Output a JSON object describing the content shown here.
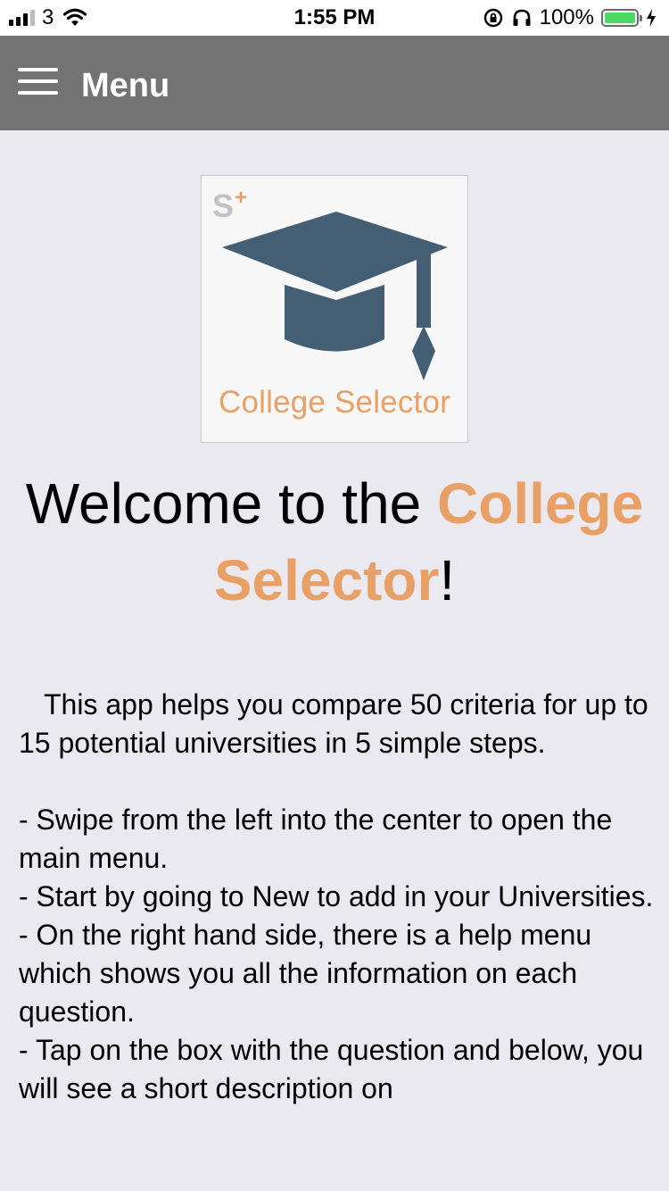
{
  "status_bar": {
    "carrier": "3",
    "time": "1:55 PM",
    "battery_percent": "100%",
    "battery_level": 1.0,
    "signal_bars_filled": 3,
    "signal_bars_total": 4,
    "icons": [
      "signal-icon",
      "wifi-icon",
      "orientation-lock-icon",
      "headphones-icon",
      "battery-icon",
      "charging-icon"
    ]
  },
  "nav": {
    "menu_icon": "hamburger-menu-icon",
    "title": "Menu"
  },
  "logo": {
    "badge": "S+",
    "text": "College Selector",
    "icon": "graduation-cap-icon"
  },
  "welcome": {
    "prefix": "Welcome to the ",
    "app_name": "College Selector",
    "suffix": "!"
  },
  "body": {
    "intro": "This app helps you compare 50 criteria for up to 15 potential universities in 5 simple steps.",
    "bullets": [
      "- Swipe from the left into the center to open the main menu.",
      "- Start by going to New to add in your Universities.",
      "- On the right hand side, there is a help menu which shows you all the information on each question.",
      "- Tap on the box with the question and below, you will see a short description on"
    ]
  },
  "colors": {
    "accent": "#e8a066",
    "nav_background": "#737373",
    "page_background": "#eae9ef",
    "cap": "#445e74"
  }
}
